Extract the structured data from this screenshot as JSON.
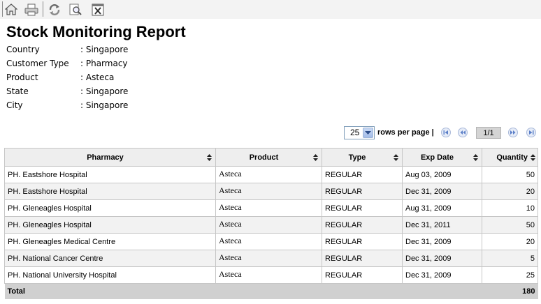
{
  "toolbar": {
    "icons": [
      "home-icon",
      "print-icon",
      "refresh-icon",
      "preview-icon",
      "excel-export-icon"
    ]
  },
  "report": {
    "title": "Stock Monitoring Report",
    "filters": [
      {
        "label": "Country",
        "value": ": Singapore"
      },
      {
        "label": "Customer Type",
        "value": ": Pharmacy"
      },
      {
        "label": "Product",
        "value": ": Asteca"
      },
      {
        "label": "State",
        "value": ": Singapore"
      },
      {
        "label": "City",
        "value": ": Singapore"
      }
    ]
  },
  "pager": {
    "rows_per_page": "25",
    "rows_label": "rows per page |",
    "page_indicator": "1/1"
  },
  "table": {
    "columns": [
      "Pharmacy",
      "Product",
      "Type",
      "Exp Date",
      "Quantity"
    ],
    "rows": [
      [
        "PH. Eastshore Hospital",
        "Asteca",
        "REGULAR",
        "Aug 03, 2009",
        "50"
      ],
      [
        "PH. Eastshore Hospital",
        "Asteca",
        "REGULAR",
        "Dec 31, 2009",
        "20"
      ],
      [
        "PH. Gleneagles Hospital",
        "Asteca",
        "REGULAR",
        "Aug 31, 2009",
        "10"
      ],
      [
        "PH. Gleneagles Hospital",
        "Asteca",
        "REGULAR",
        "Dec 31, 2011",
        "50"
      ],
      [
        "PH. Gleneagles Medical Centre",
        "Asteca",
        "REGULAR",
        "Dec 31, 2009",
        "20"
      ],
      [
        "PH. National Cancer Centre",
        "Asteca",
        "REGULAR",
        "Dec 31, 2009",
        "5"
      ],
      [
        "PH. National University Hospital",
        "Asteca",
        "REGULAR",
        "Dec 31, 2009",
        "25"
      ]
    ],
    "total_label": "Total",
    "total_value": "180"
  },
  "colors": {
    "toolbar_bg": "#f3f3f3",
    "header_bg": "#eeeeee",
    "alt_row_bg": "#f2f2f2",
    "total_bg": "#d0d0d0",
    "nav_icon": "#5b7fc8"
  }
}
